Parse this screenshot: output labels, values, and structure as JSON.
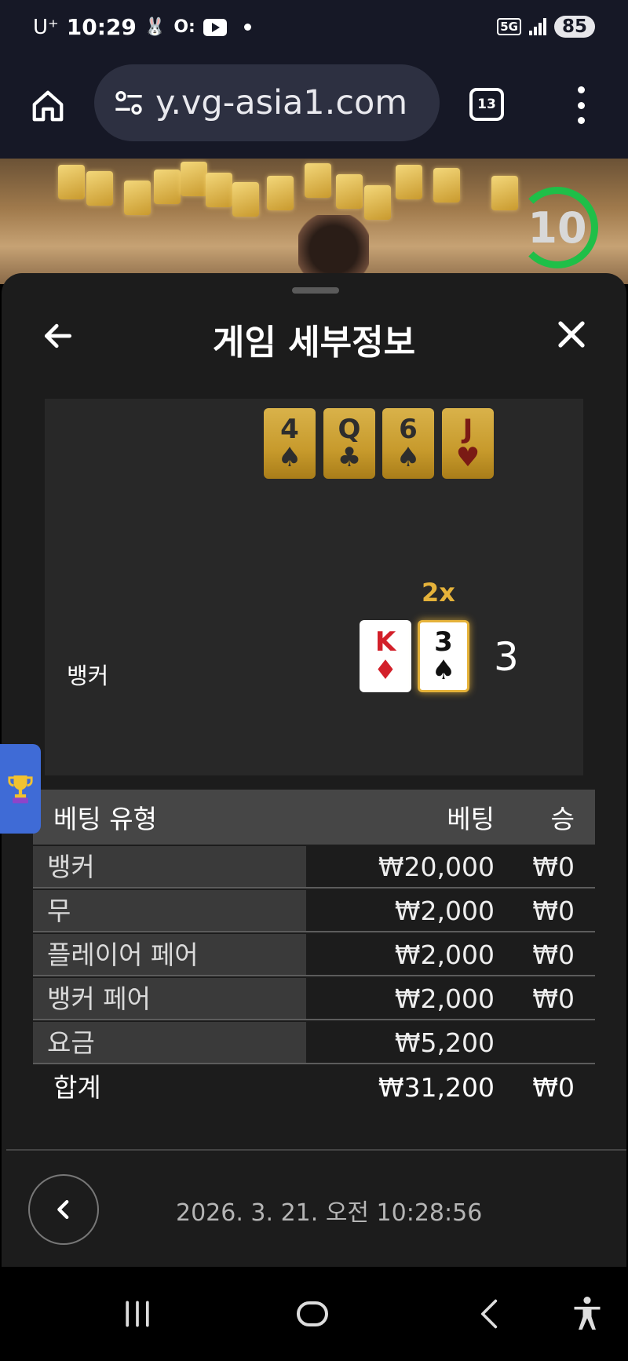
{
  "status_bar": {
    "carrier": "U⁺",
    "time": "10:29",
    "network": "5G",
    "battery": "85"
  },
  "browser": {
    "url": "y.vg-asia1.com",
    "tab_count": "13"
  },
  "game": {
    "timer": "10"
  },
  "sheet": {
    "title": "게임 세부정보",
    "top_cards": [
      {
        "rank": "4",
        "suit": "♠"
      },
      {
        "rank": "Q",
        "suit": "♣"
      },
      {
        "rank": "6",
        "suit": "♠"
      },
      {
        "rank": "J",
        "suit": "♥"
      }
    ],
    "banker": {
      "label": "뱅커",
      "multiplier": "2x",
      "score": "3",
      "cards": [
        {
          "rank": "K",
          "suit": "♦",
          "color": "#d3202a"
        },
        {
          "rank": "3",
          "suit": "♠",
          "color": "#111111"
        }
      ]
    },
    "bet_table": {
      "headers": {
        "type": "베팅 유형",
        "bet": "베팅",
        "win": "승"
      },
      "rows": [
        {
          "name": "뱅커",
          "bet": "₩20,000",
          "win": "₩0"
        },
        {
          "name": "무",
          "bet": "₩2,000",
          "win": "₩0"
        },
        {
          "name": "플레이어 페어",
          "bet": "₩2,000",
          "win": "₩0"
        },
        {
          "name": "뱅커 페어",
          "bet": "₩2,000",
          "win": "₩0"
        },
        {
          "name": "요금",
          "bet": "₩5,200",
          "win": ""
        }
      ],
      "total": {
        "name": "합계",
        "bet": "₩31,200",
        "win": "₩0"
      }
    },
    "timestamp": "2026. 3. 21. 오전 10:28:56"
  },
  "icons": {
    "home": "home-icon",
    "tune": "site-settings-icon",
    "menu": "more-vert-icon",
    "back": "arrow-left-icon",
    "close": "close-icon",
    "prev": "chevron-left-icon",
    "trophy": "trophy-icon"
  }
}
